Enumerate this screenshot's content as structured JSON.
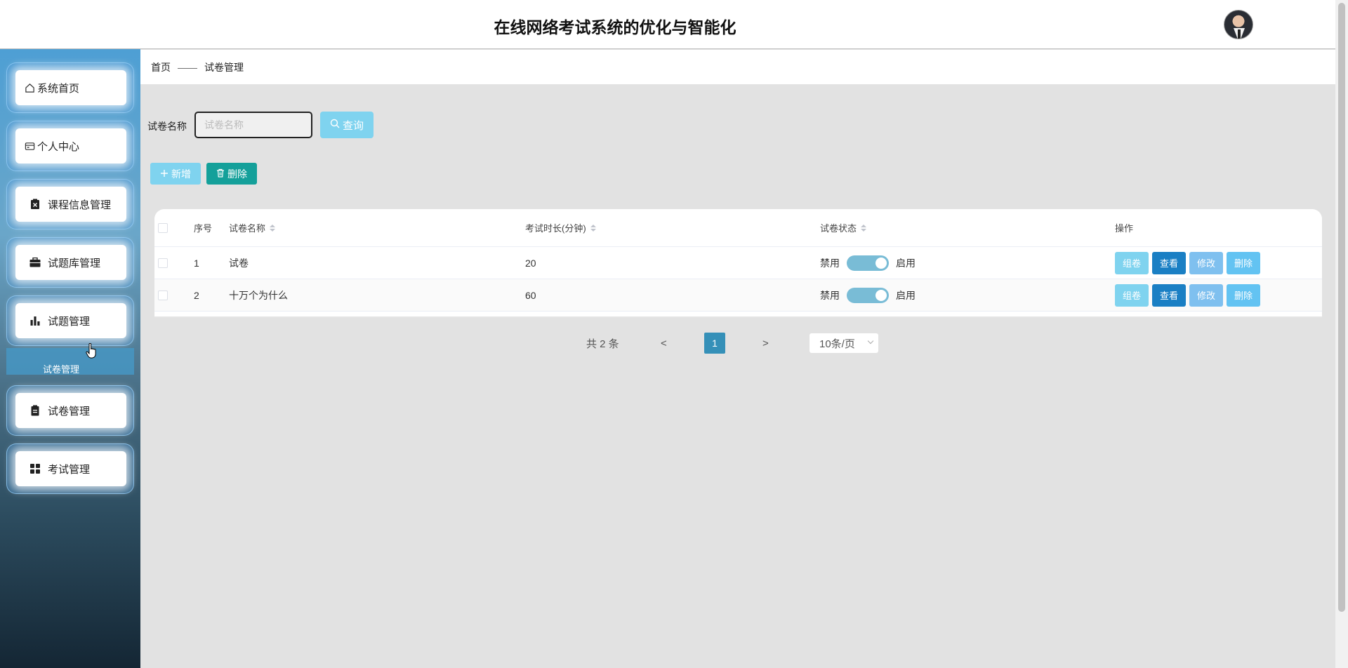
{
  "header": {
    "title": "在线网络考试系统的优化与智能化"
  },
  "sidebar": {
    "items": [
      {
        "label": "系统首页",
        "icon": "home-icon"
      },
      {
        "label": "个人中心",
        "icon": "wallet-icon"
      },
      {
        "label": "课程信息管理",
        "icon": "clipboard-x-icon"
      },
      {
        "label": "试题库管理",
        "icon": "briefcase-icon"
      },
      {
        "label": "试题管理",
        "icon": "bar-chart-icon"
      },
      {
        "label": "试卷管理",
        "icon": "clipboard-icon"
      },
      {
        "label": "考试管理",
        "icon": "grid-icon"
      }
    ],
    "submenu_label": "试卷管理"
  },
  "breadcrumb": {
    "home": "首页",
    "separator": "——",
    "current": "试卷管理"
  },
  "search": {
    "label": "试卷名称",
    "placeholder": "试卷名称",
    "button": "查询"
  },
  "toolbar": {
    "add": "新增",
    "delete": "删除"
  },
  "table": {
    "columns": {
      "index": "序号",
      "name": "试卷名称",
      "duration": "考试时长(分钟)",
      "status": "试卷状态",
      "actions": "操作"
    },
    "rows": [
      {
        "index": "1",
        "name": "试卷",
        "duration": "20",
        "off": "禁用",
        "on": "启用"
      },
      {
        "index": "2",
        "name": "十万个为什么",
        "duration": "60",
        "off": "禁用",
        "on": "启用"
      }
    ],
    "action_labels": {
      "compose": "组卷",
      "view": "查看",
      "edit": "修改",
      "delete": "删除"
    }
  },
  "pagination": {
    "total": "共 2 条",
    "prev": "<",
    "page": "1",
    "next": ">",
    "page_size": "10条/页"
  },
  "colors": {
    "accent": "#7fd3ef",
    "danger": "#14a09a",
    "view": "#1a7fc4",
    "active_page": "#3590b8"
  }
}
